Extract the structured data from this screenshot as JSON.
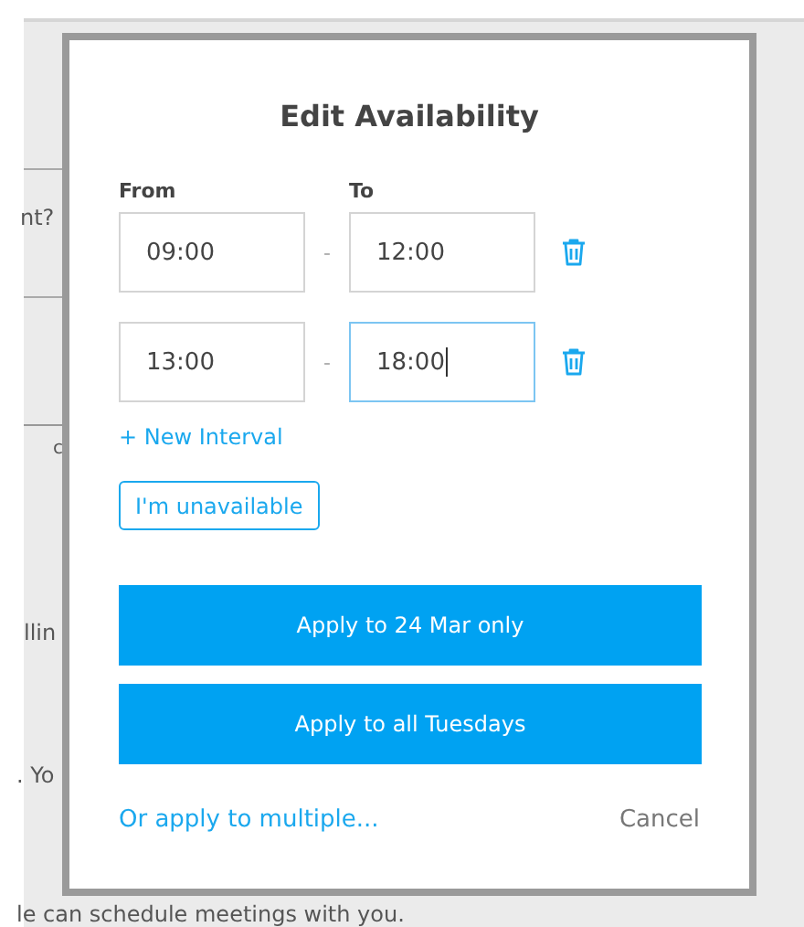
{
  "background": {
    "texts": [
      "nt?",
      "c",
      "llin",
      ". Yo",
      "le can schedule meetings with you."
    ]
  },
  "dialog": {
    "title": "Edit Availability",
    "from_label": "From",
    "to_label": "To",
    "intervals": [
      {
        "from": {
          "value": "09:00",
          "focused": false
        },
        "separator": "-",
        "to": {
          "value": "12:00",
          "focused": false
        }
      },
      {
        "from": {
          "value": "13:00",
          "focused": false
        },
        "separator": "-",
        "to": {
          "value": "18:00",
          "focused": true
        }
      }
    ],
    "new_interval": "+ New Interval",
    "unavailable_button": "I'm unavailable",
    "apply_buttons": [
      "Apply to 24 Mar only",
      "Apply to all Tuesdays"
    ],
    "multiple_link": "Or apply to multiple...",
    "cancel": "Cancel"
  }
}
